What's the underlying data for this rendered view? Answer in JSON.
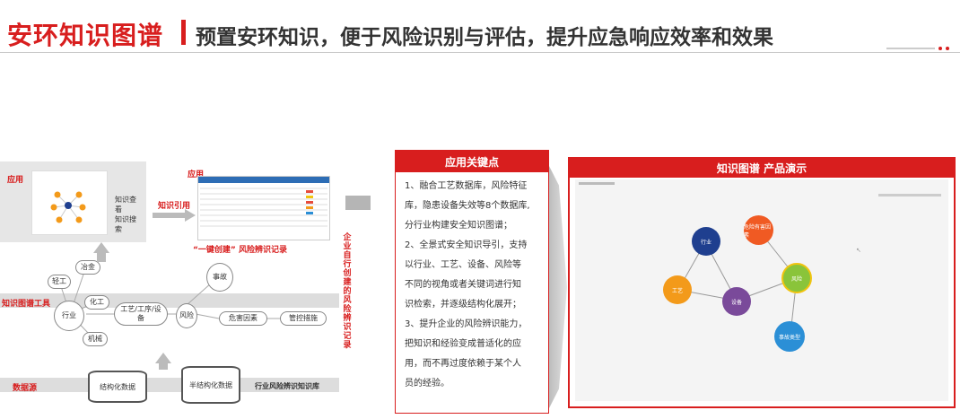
{
  "header": {
    "title": "安环知识图谱",
    "subtitle": "预置安环知识，便于风险识别与评估，提升应急响应效率和效果"
  },
  "diagram": {
    "app_label": "应用",
    "app_label2": "应用",
    "knowledge_view": "知识查看",
    "knowledge_search": "知识搜索",
    "knowledge_ref": "知识引用",
    "one_click": "“一键创建” 风险辨识记录",
    "enterprise_vertical": "企业自行创建的风险辨识记录",
    "tool_label": "知识图谱工具",
    "source_label": "数据源",
    "industry_db": "行业风险辨识知识库",
    "nodes": {
      "industry": "行业",
      "light": "轻工",
      "metallurgy": "冶金",
      "chemical": "化工",
      "machinery": "机械",
      "process": "工艺/工序/设备",
      "risk": "风险",
      "accident": "事故",
      "hazard": "危害因素",
      "control": "管控措施"
    },
    "structured": "结构化数据",
    "semi_structured": "半结构化数据"
  },
  "key_points": {
    "title": "应用关键点",
    "lines": [
      "1、融合工艺数据库，风险特征",
      "库，隐患设备失效等8个数据库,",
      "分行业构建安全知识图谱；",
      "2、全景式安全知识导引，支持",
      "以行业、工艺、设备、风险等",
      "不同的视角或者关键词进行知",
      "识检索，并逐级结构化展开；",
      "3、提升企业的风险辨识能力，",
      "把知识和经验变成普适化的应",
      "用，而不再过度依赖于某个人",
      "员的经验。"
    ]
  },
  "demo": {
    "title": "知识图谱 产品演示",
    "nodes": {
      "industry": "行业",
      "process": "工艺",
      "equipment": "设备",
      "risk": "风险",
      "accident_type": "事故类型",
      "hazard": "危险有害因素"
    }
  },
  "colors": {
    "brand_red": "#d81e1e",
    "node_navy": "#1f3f8f",
    "node_orange": "#f39a1a",
    "node_purple": "#7a4a9a",
    "node_green": "#8ac43a",
    "node_blue": "#2b8fd6",
    "node_red_orange": "#f05a23"
  }
}
